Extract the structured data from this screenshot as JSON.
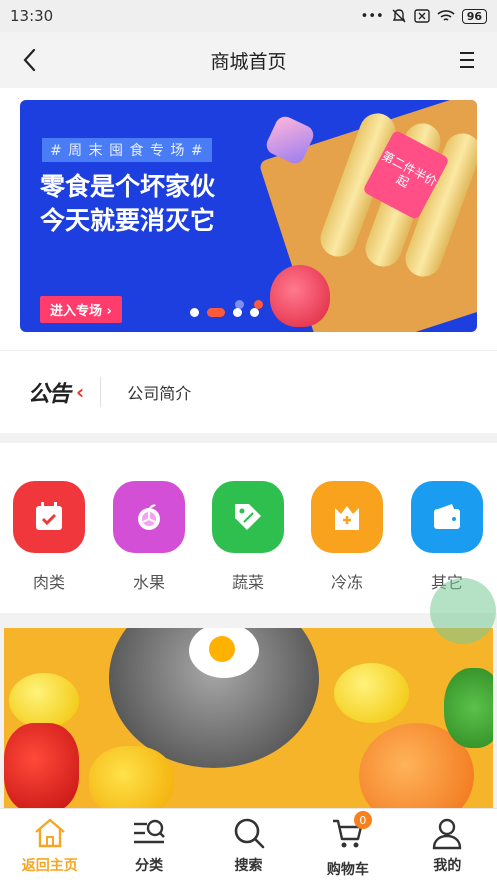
{
  "status_bar": {
    "time": "13:30",
    "battery": "96"
  },
  "navbar": {
    "title": "商城首页"
  },
  "banner": {
    "tag": "# 周 末 囤 食 专 场 #",
    "headline_1": "零食是个坏家伙",
    "headline_2": "今天就要消灭它",
    "enter_button": "进入专场 ›",
    "stamp": "第二件半价起"
  },
  "notice": {
    "logo": "公告",
    "text": "公司简介"
  },
  "categories": [
    {
      "label": "肉类",
      "color": "#f0383c",
      "icon": "calendar-check-icon"
    },
    {
      "label": "水果",
      "color": "#d24fd6",
      "icon": "orange-fruit-icon"
    },
    {
      "label": "蔬菜",
      "color": "#2fbf4e",
      "icon": "discount-tag-icon"
    },
    {
      "label": "冷冻",
      "color": "#f8a21d",
      "icon": "crown-box-icon"
    },
    {
      "label": "其它",
      "color": "#1a9cf0",
      "icon": "wallet-icon"
    }
  ],
  "tabbar": {
    "items": [
      {
        "label": "返回主页",
        "icon": "home-icon",
        "active": true
      },
      {
        "label": "分类",
        "icon": "category-search-icon",
        "active": false
      },
      {
        "label": "搜索",
        "icon": "search-icon",
        "active": false
      },
      {
        "label": "购物车",
        "icon": "cart-icon",
        "active": false,
        "badge": "0"
      },
      {
        "label": "我的",
        "icon": "user-icon",
        "active": false
      }
    ]
  },
  "colors": {
    "accent": "#f5a623",
    "banner_bg": "#1e3fe0"
  }
}
